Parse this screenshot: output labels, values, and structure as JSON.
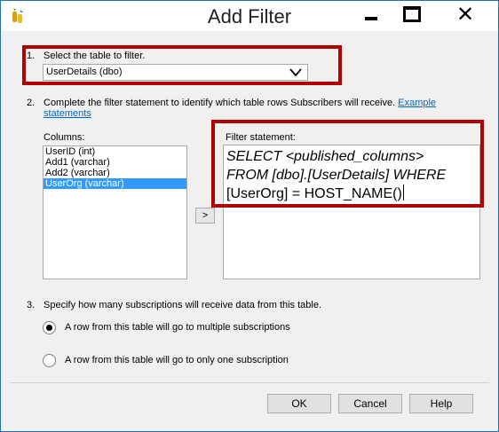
{
  "window": {
    "title": "Add Filter",
    "minimize": "minimize",
    "maximize": "maximize",
    "close": "close"
  },
  "step1": {
    "number": "1.",
    "label": "Select the table to filter.",
    "selected_table": "UserDetails (dbo)"
  },
  "step2": {
    "number": "2.",
    "label": "Complete the filter statement to identify which table rows Subscribers will receive.",
    "link_line1": "Example",
    "link_line2": "statements",
    "columns_label": "Columns:",
    "columns": [
      "UserID (int)",
      "Add1 (varchar)",
      "Add2 (varchar)",
      "UserOrg (varchar)"
    ],
    "selected_column": "UserOrg (varchar)",
    "add_button": ">",
    "filter_label": "Filter statement:",
    "filter_line1": "SELECT <published_columns>",
    "filter_line2": "FROM [dbo].[UserDetails] WHERE",
    "filter_line3": "[UserOrg] = HOST_NAME()"
  },
  "step3": {
    "number": "3.",
    "label": "Specify how many subscriptions will receive data from this table.",
    "option_multiple": "A row from this table will go to multiple subscriptions",
    "option_single": "A row from this table will go to only one subscription",
    "selected": "multiple"
  },
  "buttons": {
    "ok": "OK",
    "cancel": "Cancel",
    "help": "Help"
  },
  "colors": {
    "highlight_border": "#b00000",
    "selection": "#3399ff",
    "link": "#0066cc"
  }
}
